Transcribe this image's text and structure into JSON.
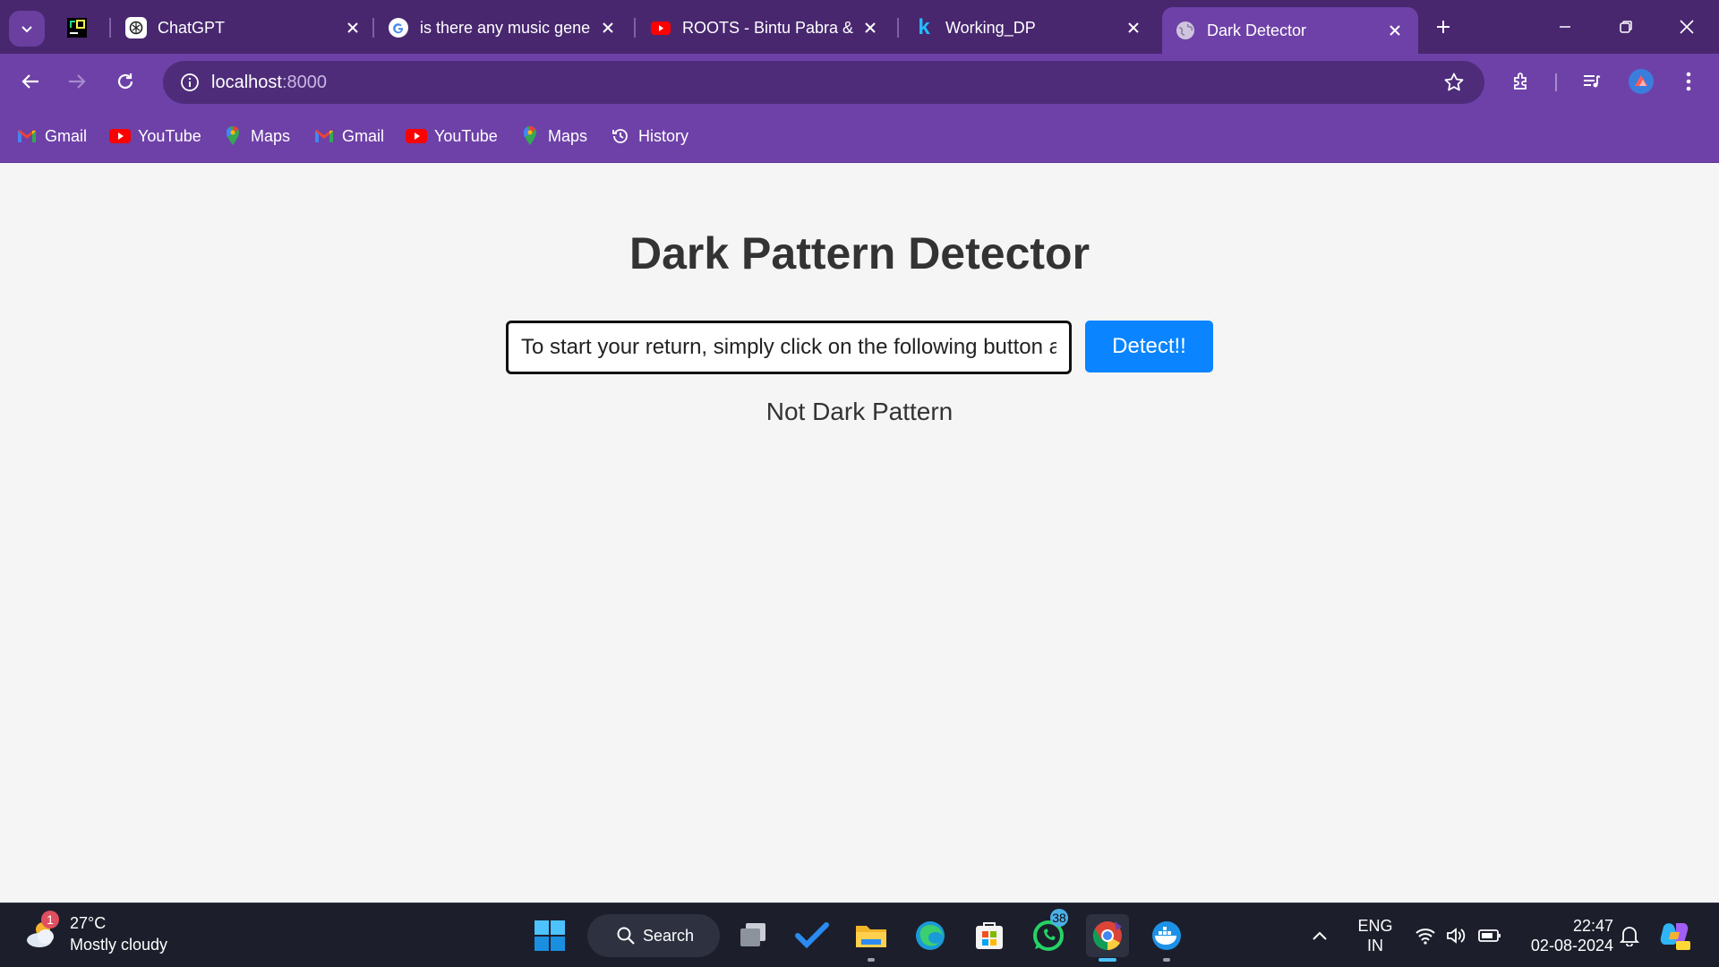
{
  "browser": {
    "tabs": [
      {
        "title": "",
        "icon": "pycharm-icon"
      },
      {
        "title": "ChatGPT",
        "icon": "chatgpt-icon"
      },
      {
        "title": "is there any music gene",
        "icon": "google-icon"
      },
      {
        "title": "ROOTS - Bintu Pabra &",
        "icon": "youtube-icon"
      },
      {
        "title": "Working_DP",
        "icon": "kaggle-icon"
      },
      {
        "title": "Dark Detector",
        "icon": "globe-icon",
        "active": true
      }
    ],
    "address": {
      "host": "localhost",
      "port": ":8000"
    },
    "bookmarks": [
      {
        "label": "Gmail",
        "icon": "gmail-icon"
      },
      {
        "label": "YouTube",
        "icon": "youtube-icon"
      },
      {
        "label": "Maps",
        "icon": "maps-icon"
      },
      {
        "label": "Gmail",
        "icon": "gmail-icon"
      },
      {
        "label": "YouTube",
        "icon": "youtube-icon"
      },
      {
        "label": "Maps",
        "icon": "maps-icon"
      },
      {
        "label": "History",
        "icon": "history-icon"
      }
    ],
    "colors": {
      "frame": "#48276f",
      "toolbar": "#6e41a8",
      "omnibox": "#4e2c7a"
    }
  },
  "page": {
    "title": "Dark Pattern Detector",
    "input_value": "To start your return, simply click on the following button a",
    "button_label": "Detect!!",
    "result": "Not Dark Pattern",
    "colors": {
      "button": "#0a84ff",
      "background": "#f5f5f5",
      "text": "#333333"
    }
  },
  "taskbar": {
    "weather": {
      "temp": "27°C",
      "condition": "Mostly cloudy",
      "badge": "1"
    },
    "search_label": "Search",
    "whatsapp_badge": "38",
    "language": {
      "line1": "ENG",
      "line2": "IN"
    },
    "clock": {
      "time": "22:47",
      "date": "02-08-2024"
    }
  }
}
